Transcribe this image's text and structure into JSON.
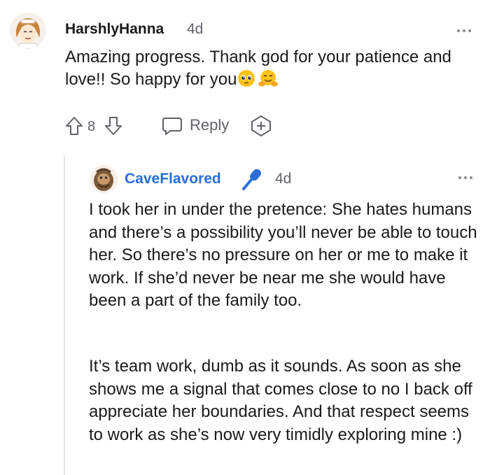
{
  "comments": [
    {
      "username": "HarshlyHanna",
      "timestamp": "4d",
      "body": "Amazing progress. Thank god for your patience and love!! So happy for you",
      "emojis": [
        "pleading-face-emoji",
        "hugging-face-emoji"
      ],
      "vote_count": "8",
      "reply_label": "Reply"
    },
    {
      "username": "CaveFlavored",
      "timestamp": "4d",
      "flair_icon": "microphone-icon",
      "paragraphs": [
        "I took her in under the pretence: She hates humans and there’s a possibility you’ll never be able to touch her. So there’s no pressure on her or me to make it work. If she’d never be near me she would have been a part of the family too.",
        "It’s team work, dumb as it sounds. As soon as she shows me a signal that comes close to no I back off appreciate her boundaries. And that respect seems to work as she’s now very timidly exploring mine :)"
      ]
    }
  ],
  "colors": {
    "username_reply": "#2a6fd6",
    "meta_gray": "#5f6368",
    "thread_line": "#e3e5e8"
  }
}
